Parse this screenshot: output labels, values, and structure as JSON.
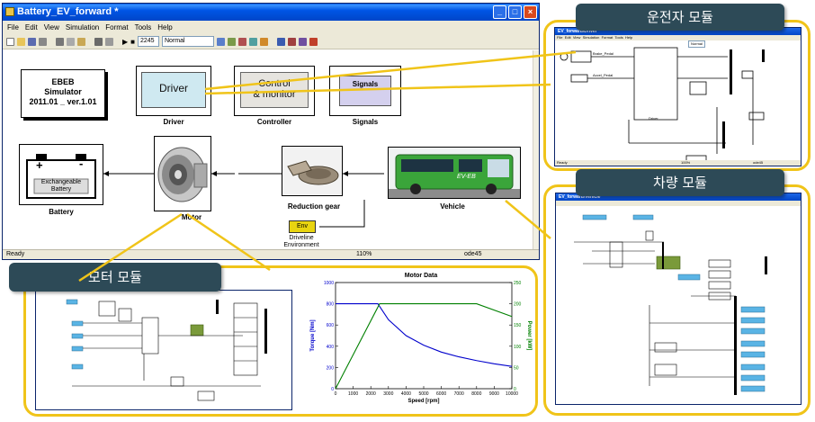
{
  "window": {
    "title": "Battery_EV_forward *",
    "menus": [
      "File",
      "Edit",
      "View",
      "Simulation",
      "Format",
      "Tools",
      "Help"
    ],
    "sim_time": "2245",
    "sim_mode": "Normal",
    "status": {
      "left": "Ready",
      "zoom": "110%",
      "solver": "ode45"
    }
  },
  "model": {
    "simulator_block": {
      "line1": "EBEB",
      "line2": "Simulator",
      "line3": "2011.01 _ ver.1.01"
    },
    "driver": {
      "inner": "Driver",
      "label": "Driver"
    },
    "controller": {
      "inner_line1": "Control",
      "inner_line2": "& monitor",
      "label": "Controller"
    },
    "signals": {
      "inner": "Signals",
      "label": "Signals"
    },
    "battery": {
      "plus": "+",
      "minus": "-",
      "line1": "Exchangeable",
      "line2": "Battery",
      "label": "Battery"
    },
    "motor": {
      "label": "Motor"
    },
    "reduction_gear": {
      "label": "Reduction gear"
    },
    "vehicle": {
      "label": "Vehicle",
      "bus_text": "EV-EB"
    },
    "env": {
      "inner": "Env",
      "label_line1": "Driveline",
      "label_line2": "Environment"
    }
  },
  "callouts": {
    "driver_module": "운전자 모듈",
    "vehicle_module": "차량 모듈",
    "motor_module": "모터 모듈"
  },
  "driver_window": {
    "title": "EV_forward/Driver",
    "menus": [
      "File",
      "Edit",
      "View",
      "Simulation",
      "Format",
      "Tools",
      "Help"
    ],
    "sim_mode": "Normal",
    "labels": {
      "brake": "Brake_Pedal",
      "accel": "Accel_Pedal",
      "block": "Driver"
    },
    "status": {
      "left": "Ready",
      "zoom": "100%",
      "solver": "ode45"
    }
  },
  "vehicle_window": {
    "title": "EV_forward/Vehicle"
  },
  "motor_chart": {
    "title": "Motor Data",
    "xlabel": "Speed [rpm]",
    "ylabel_left": "Torque [Nm]",
    "ylabel_right": "Power [kW]",
    "x_ticks": [
      "0",
      "1000",
      "2000",
      "3000",
      "4000",
      "5000",
      "6000",
      "7000",
      "8000",
      "9000",
      "10000"
    ],
    "y_left_ticks": [
      "0",
      "200",
      "400",
      "600",
      "800",
      "1000"
    ],
    "y_right_ticks": [
      "0",
      "50",
      "100",
      "150",
      "200",
      "250"
    ]
  },
  "chart_data": {
    "type": "line",
    "title": "Motor Data",
    "xlabel": "Speed [rpm]",
    "ylabel": "Torque [Nm]",
    "y2label": "Power [kW]",
    "xlim": [
      0,
      10000
    ],
    "ylim": [
      0,
      1000
    ],
    "y2lim": [
      0,
      250
    ],
    "series": [
      {
        "axis": "left",
        "color": "#0000cc",
        "x": [
          0,
          2400,
          3000,
          4000,
          5000,
          6000,
          7000,
          8000,
          9000,
          10000
        ],
        "y": [
          800,
          800,
          650,
          500,
          410,
          345,
          300,
          265,
          235,
          210
        ]
      },
      {
        "axis": "right",
        "color": "#008000",
        "x": [
          0,
          2500,
          8000,
          10000
        ],
        "y": [
          0,
          200,
          200,
          170
        ]
      }
    ]
  },
  "colors": {
    "callout_border": "#f0c419",
    "callout_tag": "#2d4a57",
    "titlebar": "#0055e5",
    "driver_block": "#cfe9f1",
    "signals_block": "#d4d0ee",
    "env_block": "#e8d410",
    "bus_green": "#3aa53a"
  }
}
